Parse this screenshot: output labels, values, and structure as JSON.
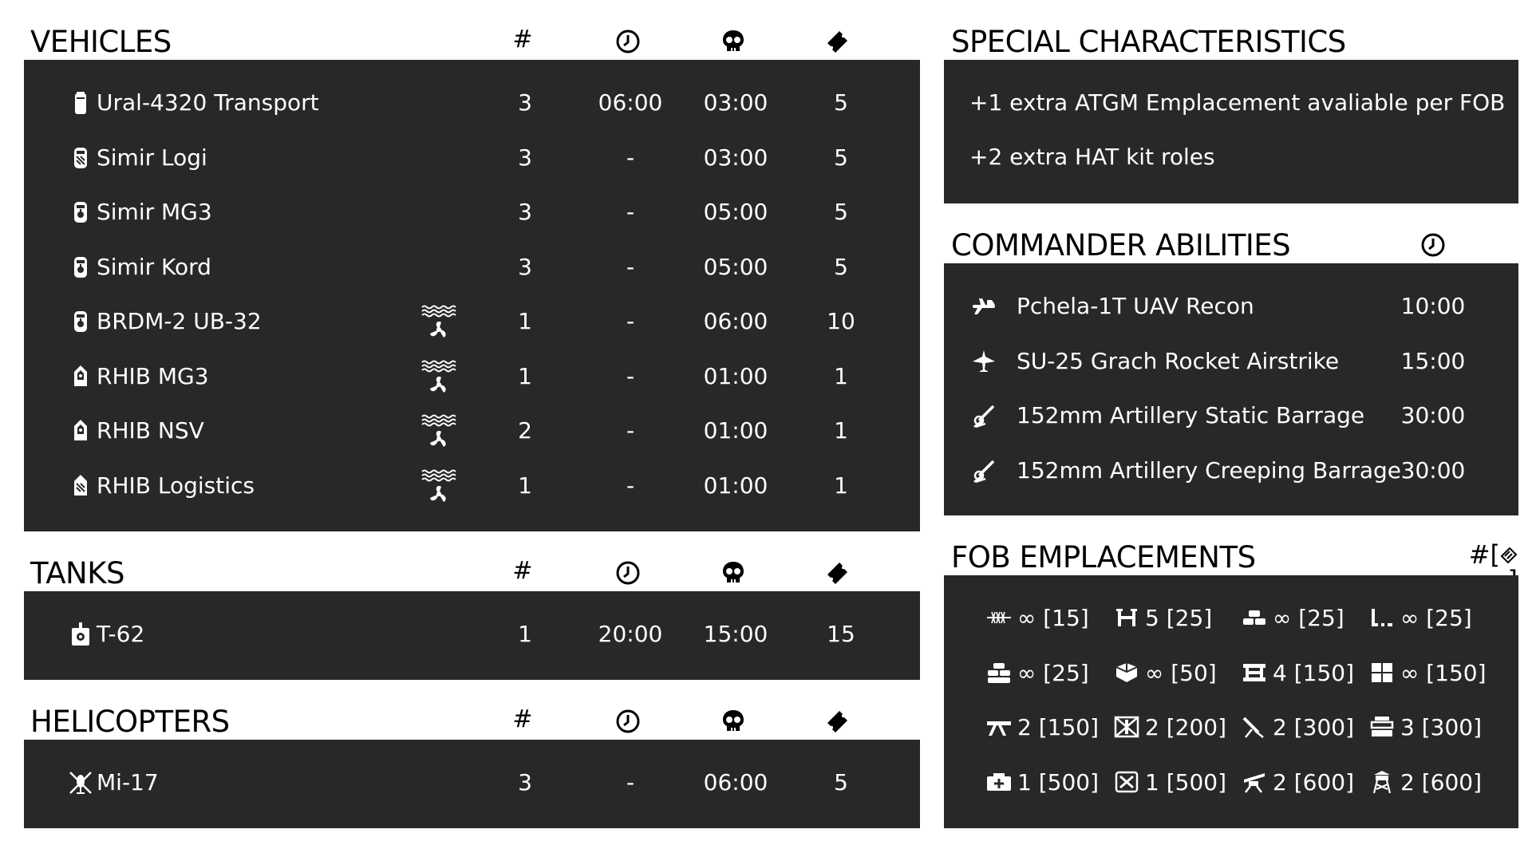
{
  "vehicles": {
    "title": "VEHICLES",
    "col_count": "#",
    "col_icons": [
      "clock-icon",
      "skull-icon",
      "ticket-icon"
    ],
    "rows": [
      {
        "name": "Ural-4320 Transport",
        "icon": "truck-icon",
        "amphibious": false,
        "count": "3",
        "delay": "06:00",
        "respawn": "03:00",
        "tickets": "5"
      },
      {
        "name": "Simir Logi",
        "icon": "logistics-car-icon",
        "amphibious": false,
        "count": "3",
        "delay": "-",
        "respawn": "03:00",
        "tickets": "5"
      },
      {
        "name": "Simir MG3",
        "icon": "armed-car-icon",
        "amphibious": false,
        "count": "3",
        "delay": "-",
        "respawn": "05:00",
        "tickets": "5"
      },
      {
        "name": "Simir Kord",
        "icon": "armed-car-icon",
        "amphibious": false,
        "count": "3",
        "delay": "-",
        "respawn": "05:00",
        "tickets": "5"
      },
      {
        "name": "BRDM-2 UB-32",
        "icon": "armed-car-icon",
        "amphibious": true,
        "count": "1",
        "delay": "-",
        "respawn": "06:00",
        "tickets": "10"
      },
      {
        "name": "RHIB MG3",
        "icon": "boat-icon",
        "amphibious": true,
        "count": "1",
        "delay": "-",
        "respawn": "01:00",
        "tickets": "1"
      },
      {
        "name": "RHIB NSV",
        "icon": "boat-icon",
        "amphibious": true,
        "count": "2",
        "delay": "-",
        "respawn": "01:00",
        "tickets": "1"
      },
      {
        "name": "RHIB Logistics",
        "icon": "logistics-boat-icon",
        "amphibious": true,
        "count": "1",
        "delay": "-",
        "respawn": "01:00",
        "tickets": "1"
      }
    ]
  },
  "tanks": {
    "title": "TANKS",
    "col_count": "#",
    "rows": [
      {
        "name": "T-62",
        "icon": "tank-icon",
        "count": "1",
        "delay": "20:00",
        "respawn": "15:00",
        "tickets": "15"
      }
    ]
  },
  "helicopters": {
    "title": "HELICOPTERS",
    "col_count": "#",
    "rows": [
      {
        "name": "Mi-17",
        "icon": "helicopter-icon",
        "count": "3",
        "delay": "-",
        "respawn": "06:00",
        "tickets": "5"
      }
    ]
  },
  "special": {
    "title": "SPECIAL CHARACTERISTICS",
    "items": [
      "+1 extra ATGM Emplacement avaliable per FOB",
      "+2 extra HAT kit roles"
    ]
  },
  "commander": {
    "title": "COMMANDER ABILITIES",
    "rows": [
      {
        "name": "Pchela-1T UAV Recon",
        "icon": "uav-icon",
        "time": "10:00"
      },
      {
        "name": "SU-25 Grach Rocket Airstrike",
        "icon": "jet-icon",
        "time": "15:00"
      },
      {
        "name": "152mm Artillery Static Barrage",
        "icon": "artillery-icon",
        "time": "30:00"
      },
      {
        "name": "152mm Artillery Creeping Barrage",
        "icon": "artillery-icon",
        "time": "30:00"
      }
    ]
  },
  "fob": {
    "title": "FOB EMPLACEMENTS",
    "header_label": "#[",
    "header_label_end": "]",
    "items": [
      {
        "icon": "razor-wire-icon",
        "text": "∞ [15]"
      },
      {
        "icon": "tank-trap-icon",
        "text": "5 [25]"
      },
      {
        "icon": "sandbag-icon",
        "text": "∞ [25]"
      },
      {
        "icon": "low-wall-icon",
        "text": "∞ [25]"
      },
      {
        "icon": "sandbag-wall-icon",
        "text": "∞ [25]"
      },
      {
        "icon": "ammo-crate-icon",
        "text": "∞ [50]"
      },
      {
        "icon": "bunker-icon",
        "text": "4 [150]"
      },
      {
        "icon": "hesco-icon",
        "text": "∞ [150]"
      },
      {
        "icon": "machine-gun-icon",
        "text": "2 [150]"
      },
      {
        "icon": "atgm-icon",
        "text": "2 [200]"
      },
      {
        "icon": "mortar-icon",
        "text": "2 [300]"
      },
      {
        "icon": "bunker-stack-icon",
        "text": "3 [300]"
      },
      {
        "icon": "repair-station-icon",
        "text": "1 [500]"
      },
      {
        "icon": "ammo-box-icon",
        "text": "1 [500]"
      },
      {
        "icon": "aa-gun-icon",
        "text": "2 [600]"
      },
      {
        "icon": "watchtower-icon",
        "text": "2 [600]"
      }
    ]
  }
}
